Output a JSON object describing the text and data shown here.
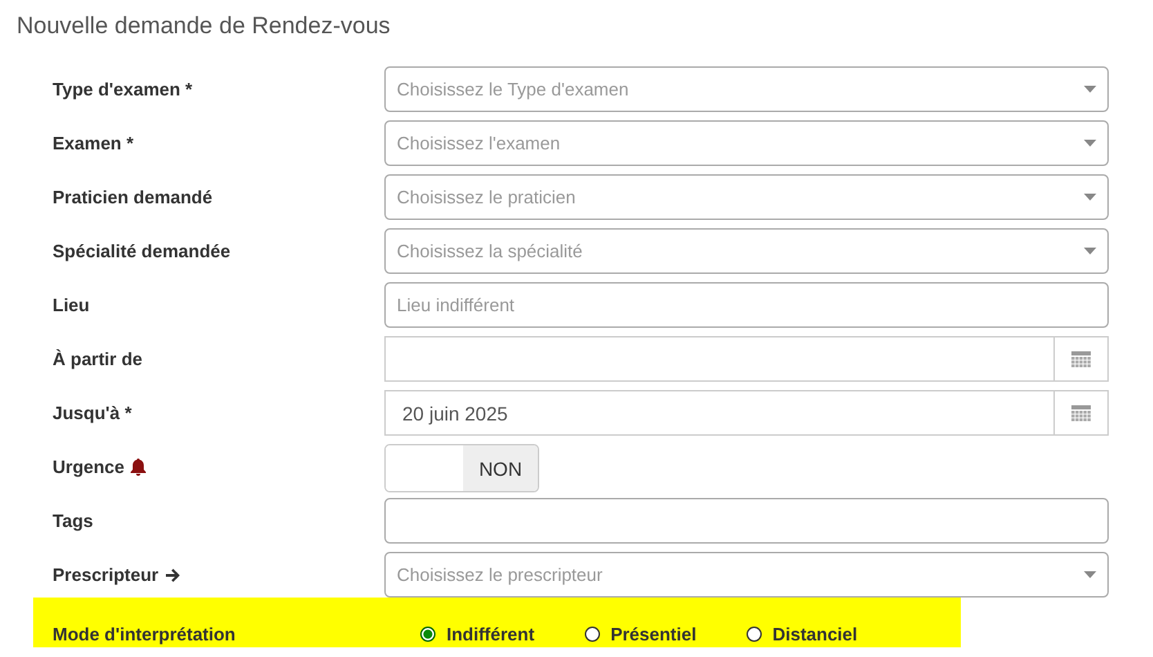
{
  "title": "Nouvelle demande de Rendez-vous",
  "fields": [
    {
      "label": "Type d'examen *",
      "kind": "select",
      "placeholder": "Choisissez le Type d'examen"
    },
    {
      "label": "Examen *",
      "kind": "select",
      "placeholder": "Choisissez l'examen"
    },
    {
      "label": "Praticien demandé",
      "kind": "select",
      "placeholder": "Choisissez le praticien"
    },
    {
      "label": "Spécialité demandée",
      "kind": "select",
      "placeholder": "Choisissez la spécialité"
    },
    {
      "label": "Lieu",
      "kind": "text",
      "placeholder": "Lieu indifférent"
    },
    {
      "label": "À partir de",
      "kind": "date"
    },
    {
      "label": "Jusqu'à *",
      "kind": "date",
      "value": "20 juin 2025"
    },
    {
      "label": "Urgence",
      "icon": {
        "kind": "bell"
      },
      "kind": "toggle",
      "on": false,
      "state_text": "NON"
    },
    {
      "label": "Tags",
      "kind": "text"
    },
    {
      "label": "Prescripteur",
      "icon": {
        "kind": "arrow"
      },
      "kind": "select",
      "placeholder": "Choisissez le prescripteur"
    }
  ],
  "interpretation": {
    "label": "Mode d'interprétation",
    "options": [
      {
        "label": "Indifférent",
        "selected": true
      },
      {
        "label": "Présentiel",
        "selected": false
      },
      {
        "label": "Distanciel",
        "selected": false
      }
    ]
  }
}
